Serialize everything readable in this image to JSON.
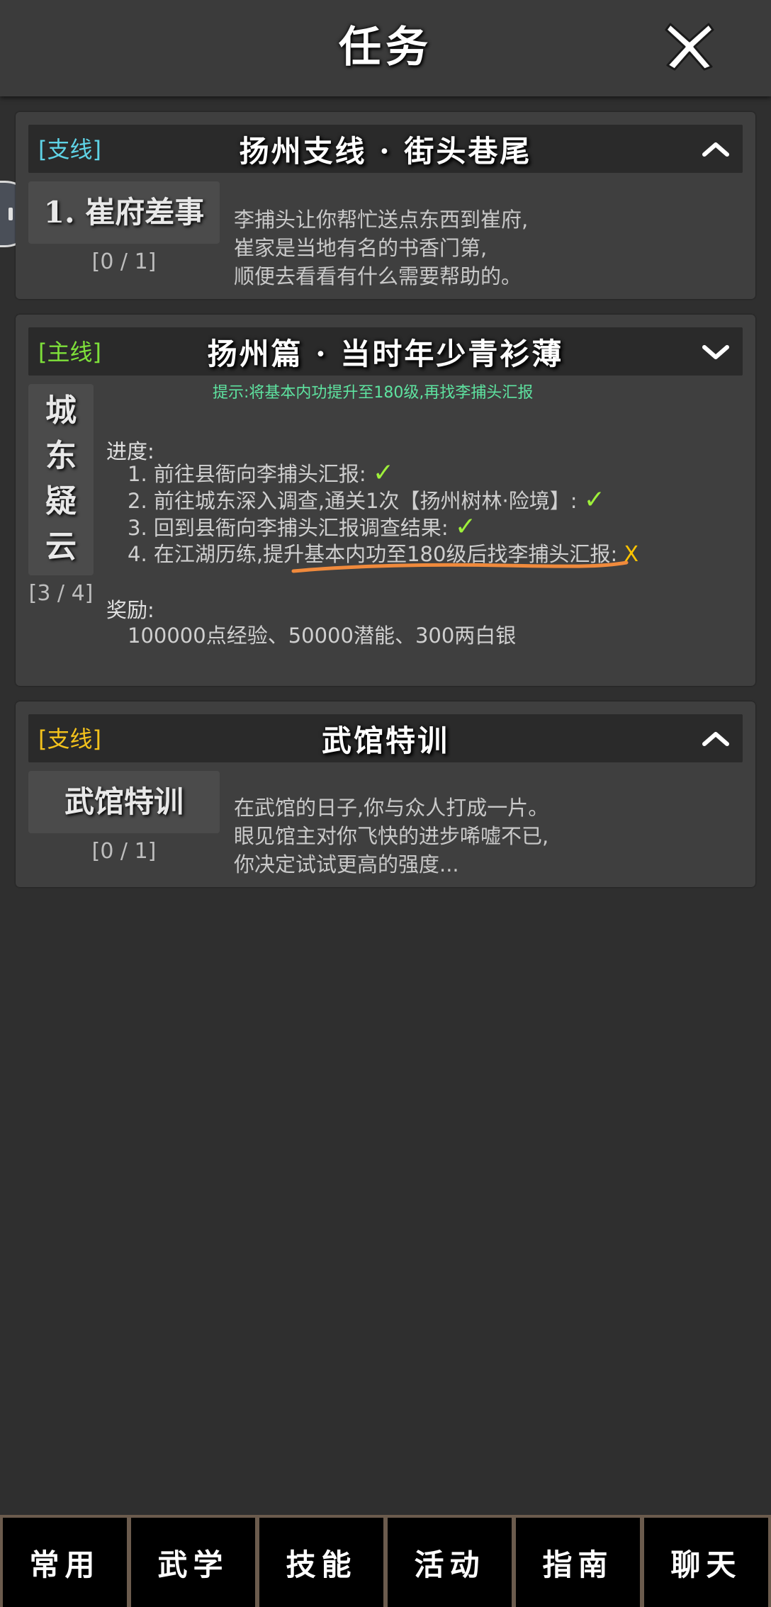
{
  "header": {
    "title": "任务"
  },
  "quests": [
    {
      "tag": "[支线]",
      "tag_color": "#5fd3e6",
      "title": "扬州支线 · 街头巷尾",
      "step": "1. 崔府差事",
      "count": "[0 / 1]",
      "description": [
        "李捕头让你帮忙送点东西到崔府,",
        "崔家是当地有名的书香门第,",
        "顺便去看看有什么需要帮助的。"
      ]
    },
    {
      "tag": "[主线]",
      "tag_color": "#7ee03a",
      "title": "扬州篇 · 当时年少青衫薄",
      "step_chars": [
        "城",
        "东",
        "疑",
        "云"
      ],
      "count": "[3 / 4]",
      "hint": "提示:将基本内功提升至180级,再找李捕头汇报",
      "progress_label": "进度:",
      "objectives": [
        {
          "text": "1. 前往县衙向李捕头汇报: ",
          "mark": "✓"
        },
        {
          "text": "2. 前往城东深入调查,通关1次【扬州树林·险境】: ",
          "mark": "✓"
        },
        {
          "text": "3. 回到县衙向李捕头汇报调查结果: ",
          "mark": "✓"
        },
        {
          "text_pre": "4. 在江湖历练,",
          "text_underlined": "提升基本内功至180级后找李捕头",
          "text_post": "汇报: ",
          "mark": "X"
        }
      ],
      "reward_label": "奖励:",
      "reward": "100000点经验、50000潜能、300两白银"
    },
    {
      "tag": "[支线]",
      "tag_color": "#f3c21c",
      "title": "武馆特训",
      "step": "武馆特训",
      "count": "[0 / 1]",
      "description": [
        "在武馆的日子,你与众人打成一片。",
        "眼见馆主对你飞快的进步唏嘘不已,",
        "你决定试试更高的强度..."
      ]
    }
  ],
  "tabs": [
    "常用",
    "武学",
    "技能",
    "活动",
    "指南",
    "聊天"
  ],
  "icons": {
    "close": "close-x-icon",
    "collapse": "chevron-up-icon",
    "expand": "chevron-down-icon",
    "side": "pause-icon"
  }
}
